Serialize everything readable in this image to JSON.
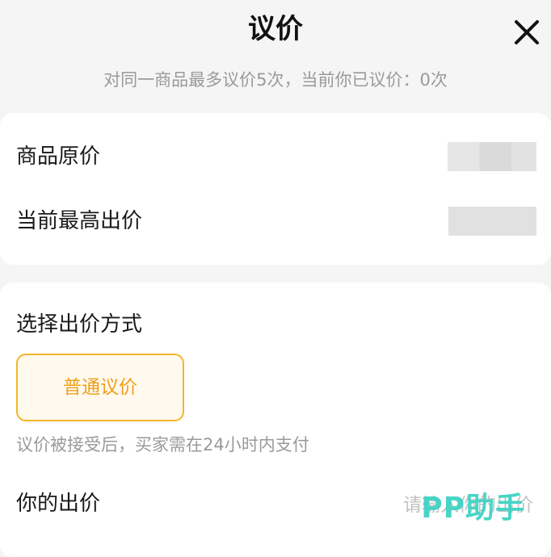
{
  "header": {
    "title": "议价",
    "subtitle": "对同一商品最多议价5次，当前你已议价：0次"
  },
  "price_info": {
    "original_price_label": "商品原价",
    "highest_bid_label": "当前最高出价"
  },
  "bid": {
    "method_label": "选择出价方式",
    "method_option": "普通议价",
    "note": "议价被接受后，买家需在24小时内支付",
    "your_bid_label": "你的出价",
    "input_placeholder": "请输入你的出价"
  },
  "watermark": "PP助手",
  "colors": {
    "accent": "#f5b52a",
    "accent_text": "#f0a01c",
    "accent_bg": "#fff9ee",
    "watermark": "#3fd3c4"
  },
  "icons": {
    "close": "close-icon"
  }
}
